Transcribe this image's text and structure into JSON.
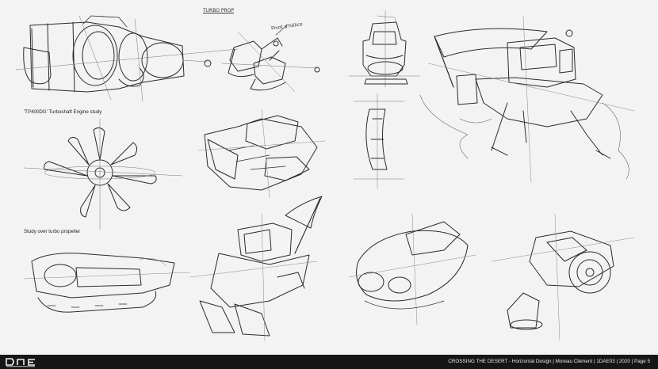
{
  "labels": {
    "engine_study": "'TP400DG' Turboshaft Engine study",
    "propeller_study": "Study over turbo propeller"
  },
  "handwritten": {
    "top_note": "TURBO PROP",
    "mount_note": "Pivot d'hélice"
  },
  "footer": {
    "logo_text": "DAE",
    "caption": "CROSSING THE DESERT - Horizontal Design | Moreau Clément | 1DAE03 | 2020 | Page 5"
  },
  "colors": {
    "paper": "#f3f3f3",
    "pencil": "#2a2a2a",
    "footer_bg": "#161616",
    "footer_text": "#e8e8e8"
  }
}
